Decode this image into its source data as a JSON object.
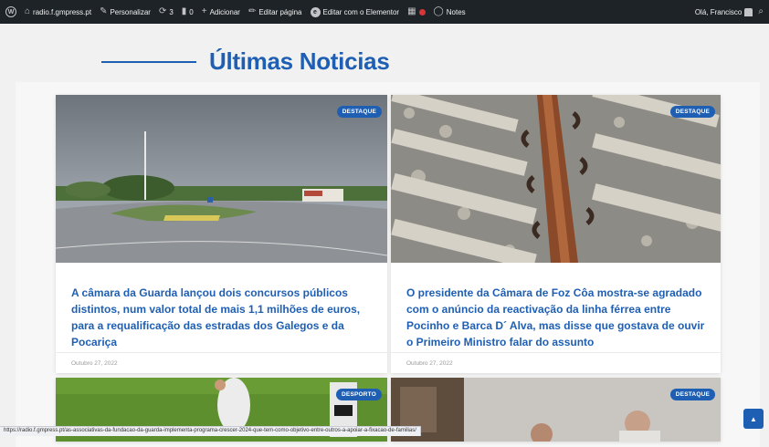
{
  "adminbar": {
    "site": "radio.f.gmpress.pt",
    "customize": "Personalizar",
    "updates": "3",
    "comments": "0",
    "add_new": "Adicionar",
    "edit_page": "Editar página",
    "edit_elementor": "Editar com o Elementor",
    "notes": "Notes",
    "greeting": "Olá, Francisco"
  },
  "section": {
    "title": "Últimas Noticias"
  },
  "posts": [
    {
      "badge": "DESTAQUE",
      "headline": "A câmara da Guarda lançou dois concursos públicos distintos, num valor total de mais 1,1 milhões de euros, para a requalificação das estradas dos Galegos e da Pocariça",
      "date": "Outubro 27, 2022"
    },
    {
      "badge": "DESTAQUE",
      "headline": "O presidente da Câmara de Foz Côa mostra-se agradado com o anúncio da reactivação da linha férrea entre Pocinho e Barca D´ Alva, mas disse que gostava de ouvir o Primeiro Ministro falar do assunto",
      "date": "Outubro 27, 2022"
    },
    {
      "badge": "DESPORTO"
    },
    {
      "badge": "DESTAQUE"
    }
  ],
  "status_url": "https://radio.f.gmpress.pt/as-associativas-da-fundacao-da-guarda-implementa-programa-crescer-2024-que-tem-como-objetivo-entre-outros-a-apoiar-a-fixacao-de-familias/",
  "colors": {
    "accent": "#1e5fb4",
    "adminbar": "#1d2327"
  }
}
